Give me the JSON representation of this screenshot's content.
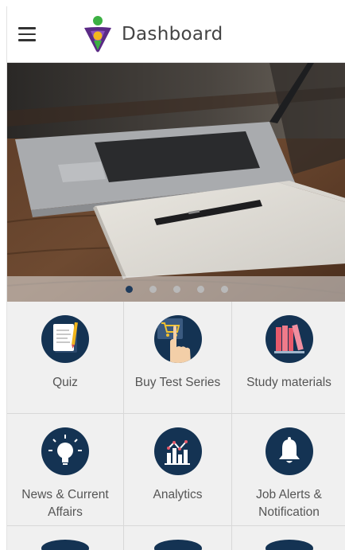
{
  "appbar": {
    "title": "Dashboard",
    "menu_icon": "hamburger-menu-icon",
    "logo_icon": "app-logo-icon"
  },
  "carousel": {
    "slide_count": 5,
    "active_index": 0
  },
  "tiles": [
    {
      "label": "Quiz",
      "icon": "quiz-clipboard-icon"
    },
    {
      "label": "Buy Test Series",
      "icon": "cart-hand-icon"
    },
    {
      "label": "Study materials",
      "icon": "books-icon"
    },
    {
      "label": "News & Current Affairs",
      "icon": "lightbulb-icon"
    },
    {
      "label": "Analytics",
      "icon": "bar-chart-icon"
    },
    {
      "label": "Job Alerts & Notification",
      "icon": "bell-icon"
    }
  ],
  "colors": {
    "primary_navy": "#143353",
    "tile_bg": "#f0f0f0",
    "active_dot": "#1f3b5c"
  }
}
